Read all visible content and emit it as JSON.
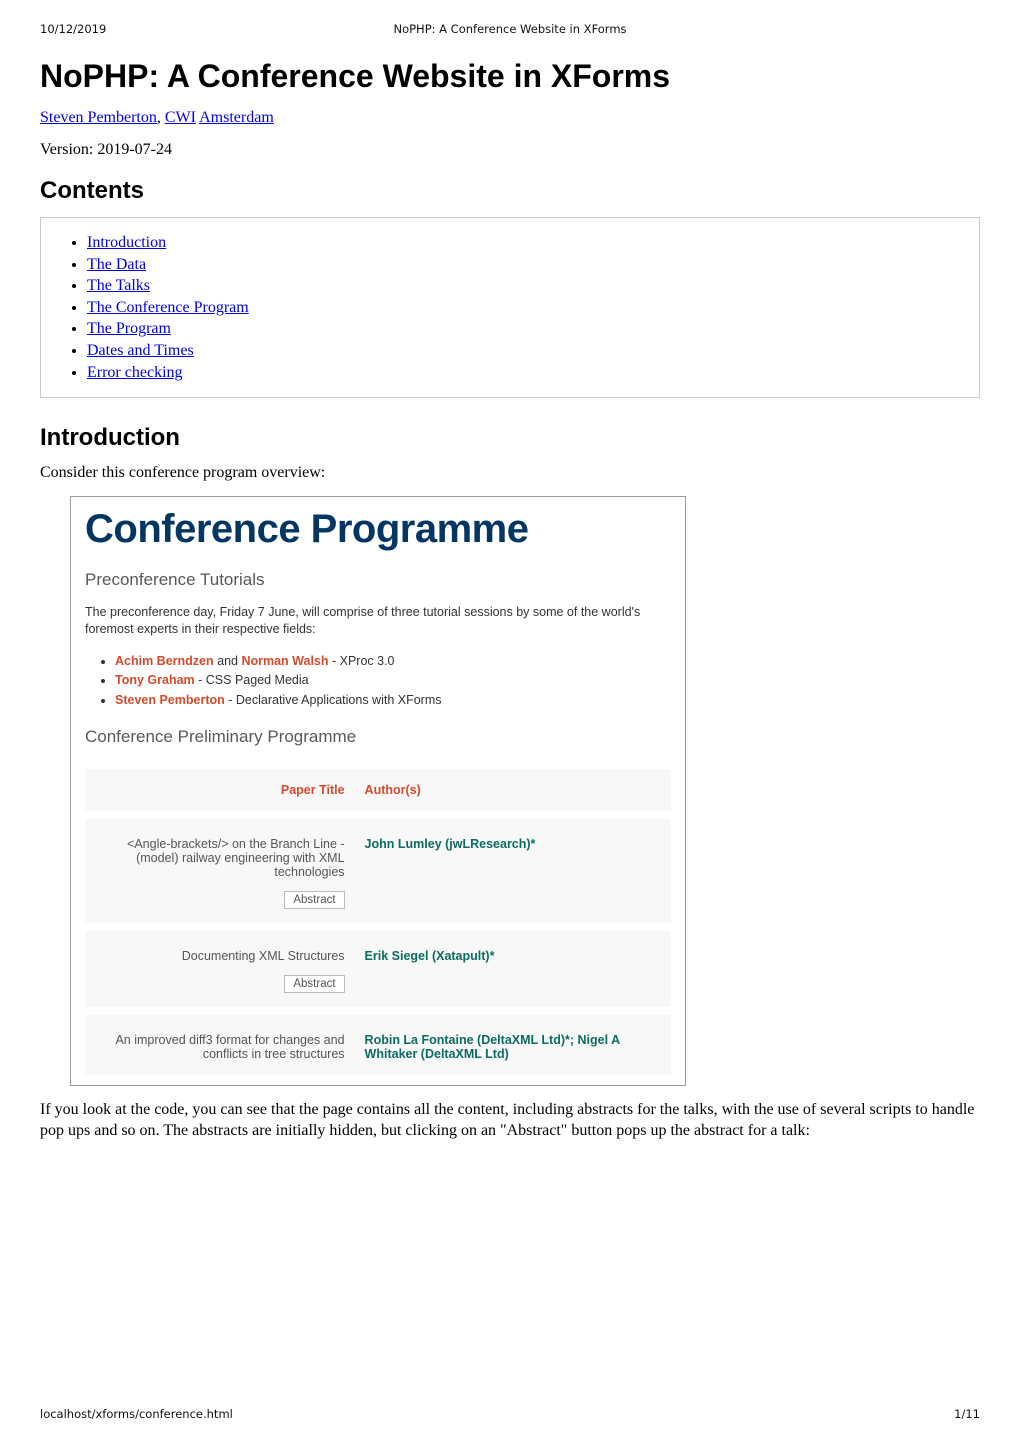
{
  "print": {
    "date": "10/12/2019",
    "title_center": "NoPHP: A Conference Website in XForms",
    "footer_left": "localhost/xforms/conference.html",
    "footer_right": "1/11"
  },
  "title": "NoPHP: A Conference Website in XForms",
  "byline": {
    "author": "Steven Pemberton",
    "org": "CWI",
    "city": "Amsterdam"
  },
  "version": "Version: 2019-07-24",
  "sections": {
    "contents": "Contents",
    "introduction": "Introduction"
  },
  "toc": [
    "Introduction",
    "The Data",
    "The Talks",
    "The Conference Program",
    "The Program",
    "Dates and Times",
    "Error checking"
  ],
  "intro_para": "Consider this conference program overview:",
  "after_para": "If you look at the code, you can see that the page contains all the content, including abstracts for the talks, with the use of several scripts to handle pop ups and so on. The abstracts are initially hidden, but clicking on an \"Abstract\" button pops up the abstract for a talk:",
  "conf": {
    "h1": "Conference Programme",
    "h2_pre": "Preconference Tutorials",
    "pre_para": "The preconference day, Friday 7 June, will comprise of three tutorial sessions by some of the world's foremost experts in their respective fields:",
    "tutorials": [
      {
        "presenters_html": [
          "Achim Berndzen",
          " and ",
          "Norman Walsh"
        ],
        "plain_joiner": " - ",
        "topic": "XProc 3.0"
      },
      {
        "presenters_html": [
          "Tony Graham"
        ],
        "plain_joiner": " - ",
        "topic": "CSS Paged Media"
      },
      {
        "presenters_html": [
          "Steven Pemberton"
        ],
        "plain_joiner": " - ",
        "topic": "Declarative Applications with XForms"
      }
    ],
    "h2_prog": "Conference Preliminary Programme",
    "th_title": "Paper Title",
    "th_auth": "Author(s)",
    "abstract_label": "Abstract",
    "rows": [
      {
        "title": "<Angle-brackets/> on the Branch Line - (model) railway engineering with XML technologies",
        "authors": "John Lumley (jwLResearch)*",
        "show_abstract_btn": true
      },
      {
        "title": "Documenting XML Structures",
        "authors": "Erik Siegel (Xatapult)*",
        "show_abstract_btn": true
      },
      {
        "title": "An improved diff3 format for changes and conflicts in tree structures",
        "authors": "Robin La Fontaine (DeltaXML Ltd)*; Nigel A Whitaker (DeltaXML Ltd)",
        "show_abstract_btn": false
      }
    ]
  }
}
